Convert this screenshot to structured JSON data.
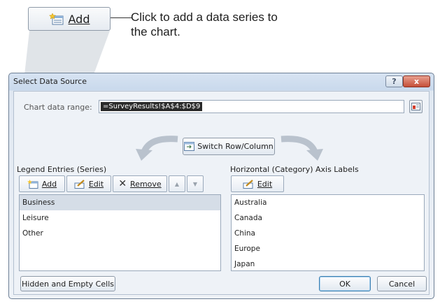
{
  "callout": {
    "button_label": "Add",
    "button_underline": "A",
    "text": "Click to add a data series to the chart."
  },
  "dialog": {
    "title": "Select Data Source",
    "help_glyph": "?",
    "close_glyph": "x",
    "chart_data_range_label": "Chart data range:",
    "chart_data_range_value": "=SurveyResults!$A$4:$D$9",
    "switch_label": "Switch Row/Column",
    "legend": {
      "label": "Legend Entries (Series)",
      "add_label": "Add",
      "edit_label": "Edit",
      "remove_label": "Remove",
      "up_glyph": "▲",
      "down_glyph": "▼",
      "items": [
        "Business",
        "Leisure",
        "Other"
      ]
    },
    "axis": {
      "label": "Horizontal (Category) Axis Labels",
      "edit_label": "Edit",
      "items": [
        "Australia",
        "Canada",
        "China",
        "Europe",
        "Japan"
      ]
    },
    "hidden_cells_label": "Hidden and Empty Cells",
    "ok_label": "OK",
    "cancel_label": "Cancel"
  },
  "colors": {
    "title_gradient_top": "#d7e3f2",
    "close_red": "#c54f38",
    "selection": "#d5dde7"
  }
}
